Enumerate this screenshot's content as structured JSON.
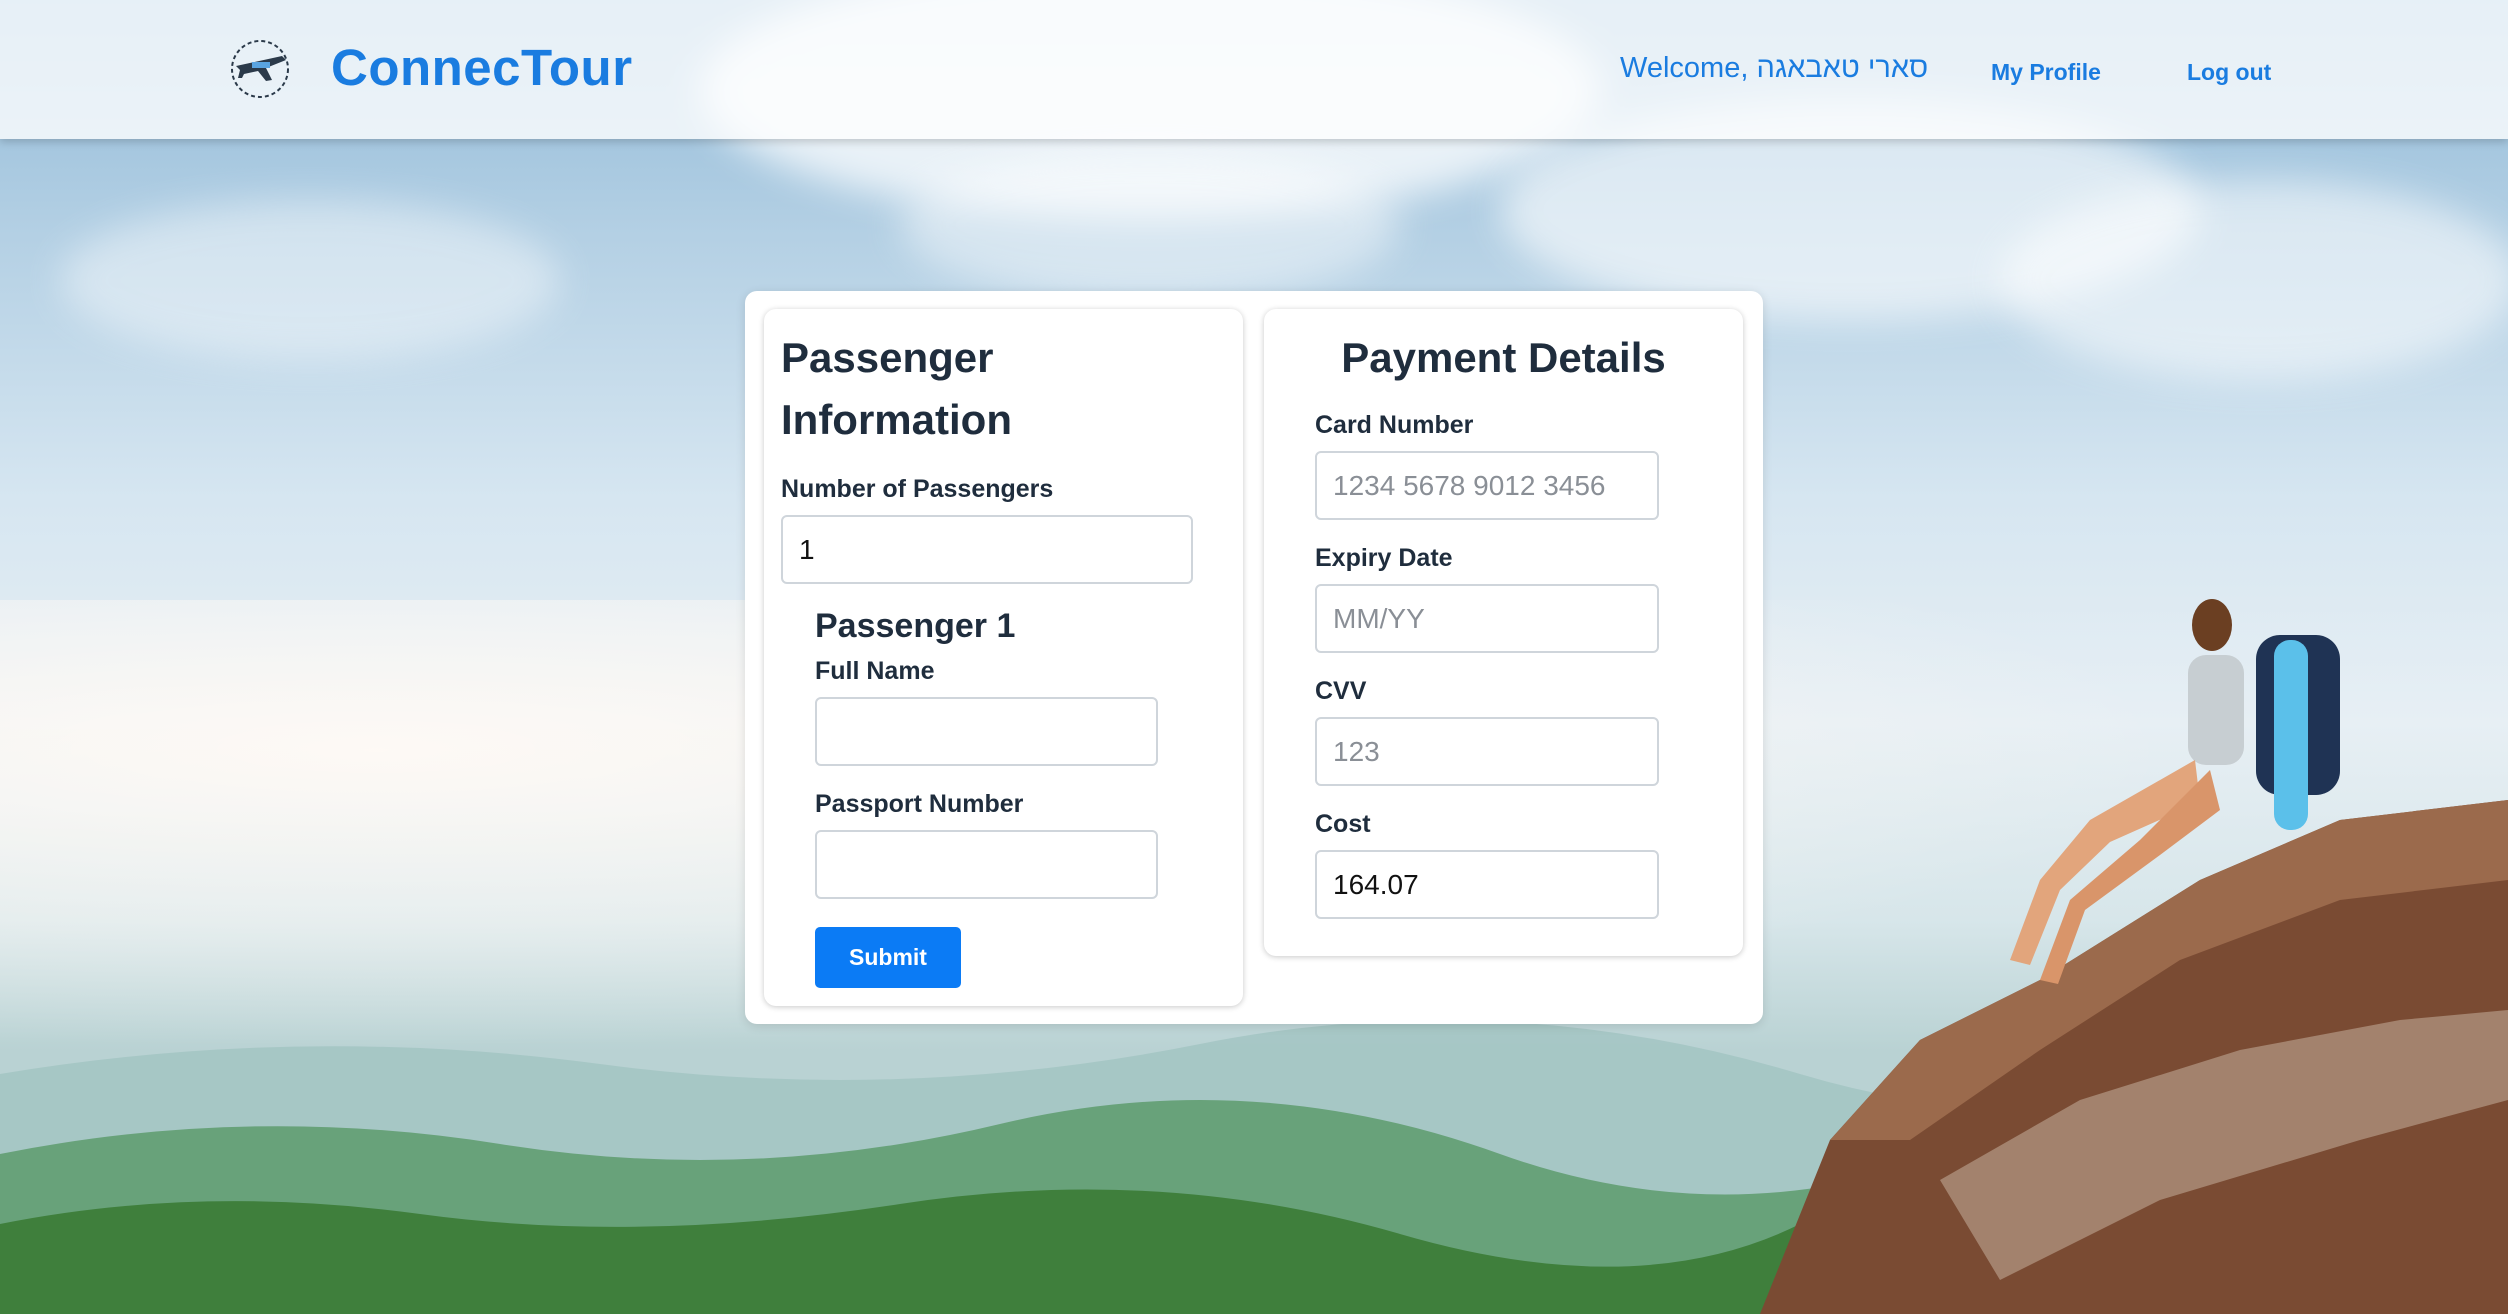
{
  "header": {
    "brand": "ConnecTour",
    "logo_text": "CONNECTOUR",
    "welcome": "Welcome, סארי טאבאגה",
    "nav": {
      "profile": "My Profile",
      "logout": "Log out"
    }
  },
  "passenger_info": {
    "title_line1": "Passenger",
    "title_line2": "Information",
    "count_label": "Number of Passengers",
    "count_value": "1",
    "passenger_title": "Passenger 1",
    "full_name_label": "Full Name",
    "full_name_value": "",
    "passport_label": "Passport Number",
    "passport_value": "",
    "submit_label": "Submit"
  },
  "payment": {
    "title": "Payment Details",
    "card_label": "Card Number",
    "card_placeholder": "1234 5678 9012 3456",
    "expiry_label": "Expiry Date",
    "expiry_placeholder": "MM/YY",
    "cvv_label": "CVV",
    "cvv_placeholder": "123",
    "cost_label": "Cost",
    "cost_value": "164.07"
  },
  "colors": {
    "brand": "#1a7ce0",
    "button": "#0b7bf5",
    "text": "#1f2d3d"
  },
  "icons": {
    "logo": "airplane-logo-icon"
  }
}
